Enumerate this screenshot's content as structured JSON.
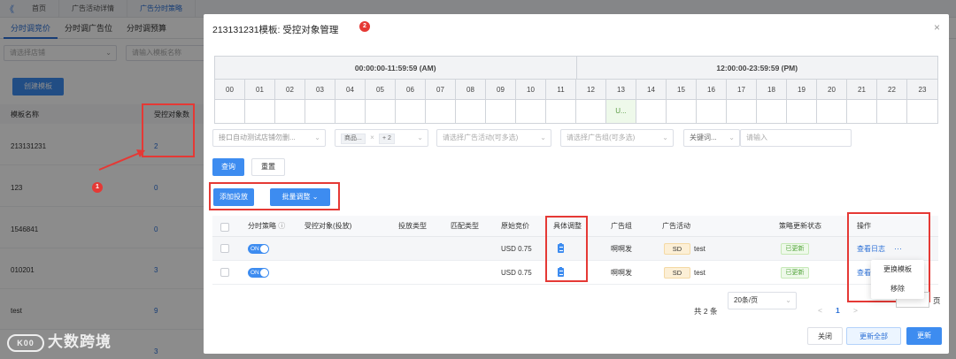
{
  "topnav": {
    "back": "《",
    "tabs": [
      "首页",
      "广告活动详情",
      "广告分时策略"
    ]
  },
  "subtabs": [
    "分时调竞价",
    "分时调广告位",
    "分时调预算"
  ],
  "bg_filters": {
    "shop_placeholder": "请选择店铺",
    "template_placeholder": "请输入模板名称"
  },
  "bg_create_button": "创建模板",
  "bg_table": {
    "headers": [
      "模板名称",
      "受控对象数"
    ],
    "rows": [
      {
        "name": "213131231",
        "count": "2"
      },
      {
        "name": "123",
        "count": "0"
      },
      {
        "name": "1546841",
        "count": "0"
      },
      {
        "name": "010201",
        "count": "3"
      },
      {
        "name": "test",
        "count": "9"
      },
      {
        "name": "",
        "count": "3"
      }
    ]
  },
  "annotations": {
    "badge1": "1",
    "badge2": "2"
  },
  "modal": {
    "title": "213131231模板: 受控对象管理",
    "close": "×",
    "schedule": {
      "am_label": "00:00:00-11:59:59 (AM)",
      "pm_label": "12:00:00-23:59:59 (PM)",
      "hours": [
        "00",
        "01",
        "02",
        "03",
        "04",
        "05",
        "06",
        "07",
        "08",
        "09",
        "10",
        "11",
        "12",
        "13",
        "14",
        "15",
        "16",
        "17",
        "18",
        "19",
        "20",
        "21",
        "22",
        "23"
      ],
      "active_hour_text": "U..."
    },
    "filters": {
      "shop_value": "接口自动测试店铺勿删...",
      "product_tag": "商品...",
      "product_more": "+ 2",
      "campaign_placeholder": "请选择广告活动(可多选)",
      "adgroup_placeholder": "请选择广告组(可多选)",
      "keyword_type": "关键词...",
      "keyword_placeholder": "请输入"
    },
    "buttons": {
      "query": "查询",
      "reset": "重置",
      "add_delivery": "添加投放",
      "batch_adjust": "批量调整"
    },
    "table": {
      "headers": [
        "分时策略",
        "受控对象(投放)",
        "投放类型",
        "匹配类型",
        "原始竞价",
        "具体调整",
        "广告组",
        "广告活动",
        "策略更新状态",
        "操作"
      ],
      "rows": [
        {
          "toggle": "ON",
          "original_bid": "USD 0.75",
          "ad_group": "啊啊发",
          "campaign_type": "SD",
          "campaign": "test",
          "status": "已更新",
          "action": "查看日志",
          "more": "···"
        },
        {
          "toggle": "ON",
          "original_bid": "USD 0.75",
          "ad_group": "啊啊发",
          "campaign_type": "SD",
          "campaign": "test",
          "status": "已更新",
          "action": "查看"
        }
      ]
    },
    "dropdown": [
      "更换模板",
      "移除"
    ],
    "pagination": {
      "total": "共 2 条",
      "page_size": "20条/页",
      "prev": "<",
      "page": "1",
      "next": ">",
      "suffix": "页"
    },
    "footer": {
      "close": "关闭",
      "update_all": "更新全部",
      "update": "更新"
    }
  },
  "watermark": {
    "logo": "K00",
    "text": "大数跨境"
  },
  "colors": {
    "primary": "#3d8cf0",
    "annotation_red": "#e53935",
    "success": "#52a33a"
  }
}
